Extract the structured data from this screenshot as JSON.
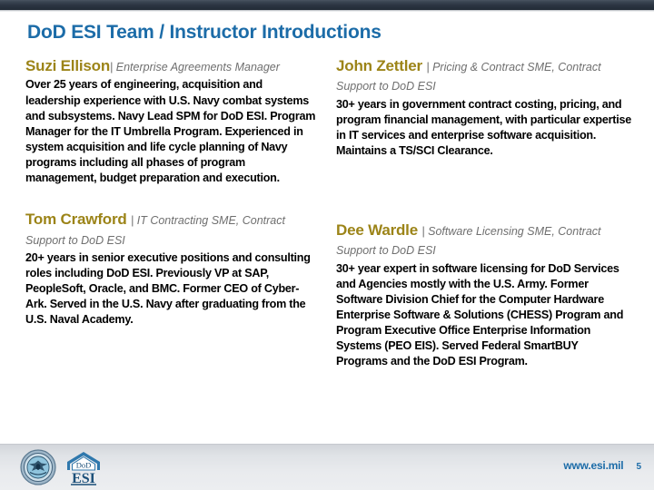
{
  "slide": {
    "title": "DoD ESI Team / Instructor Introductions",
    "page_number": "5",
    "colors": {
      "title_blue": "#1C6CA8",
      "name_gold": "#9C8418",
      "role_gray": "#6F6F6F",
      "body_black": "#000000",
      "footer_band": "#E4E7EA",
      "top_bar": "#2B3441"
    }
  },
  "columns": {
    "left": [
      {
        "name": "Suzi Ellison",
        "role": "| Enterprise Agreements Manager",
        "bio": "Over 25 years of engineering, acquisition and leadership experience with U.S. Navy combat systems and subsystems.  Navy Lead SPM for DoD ESI. Program Manager for the IT Umbrella Program. Experienced in system acquisition and life cycle planning of Navy programs including all phases of program management, budget preparation and execution."
      },
      {
        "name": "Tom Crawford",
        "role": "| IT Contracting SME, Contract Support to DoD ESI",
        "bio": "20+ years in senior executive positions and consulting roles including DoD ESI. Previously VP at SAP, PeopleSoft, Oracle, and BMC. Former CEO of Cyber-Ark. Served in the U.S. Navy after graduating from the U.S. Naval Academy."
      }
    ],
    "right": [
      {
        "name": "John Zettler",
        "role": "| Pricing & Contract SME, Contract Support to DoD ESI",
        "bio": "30+ years in government contract costing, pricing, and program financial management, with particular expertise in IT services and enterprise software acquisition. Maintains a TS/SCI Clearance."
      },
      {
        "name": "Dee Wardle",
        "role": "| Software Licensing SME, Contract Support to DoD ESI",
        "bio": "30+ year expert in software licensing for DoD Services and Agencies mostly with the U.S. Army. Former Software Division Chief for the Computer Hardware Enterprise Software & Solutions (CHESS) Program and Program Executive Office Enterprise Information Systems (PEO EIS). Served Federal SmartBUY Programs and the DoD ESI Program."
      }
    ]
  },
  "footer": {
    "url": "www.esi.mil",
    "page_number": "5",
    "logos": {
      "dod_seal": "dod-seal-icon",
      "esi_logo_top": "DoD",
      "esi_logo_main": "ESI"
    }
  }
}
